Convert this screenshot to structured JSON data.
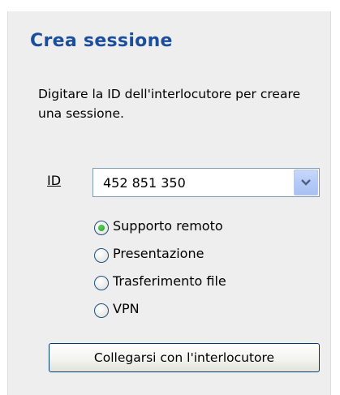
{
  "panel": {
    "title": "Crea sessione",
    "description": "Digitare la ID dell'interlocutore per creare una sessione."
  },
  "id_field": {
    "label": "ID",
    "value": "452 851 350"
  },
  "modes": [
    {
      "label": "Supporto remoto",
      "selected": true
    },
    {
      "label": "Presentazione",
      "selected": false
    },
    {
      "label": "Trasferimento file",
      "selected": false
    },
    {
      "label": "VPN",
      "selected": false
    }
  ],
  "connect_button": {
    "label": "Collegarsi con l'interlocutore"
  },
  "colors": {
    "title": "#1b4f9c",
    "panel_bg": "#eeeeee",
    "radio_selected": "#21a121"
  },
  "icons": {
    "dropdown": "chevron-down-icon"
  }
}
